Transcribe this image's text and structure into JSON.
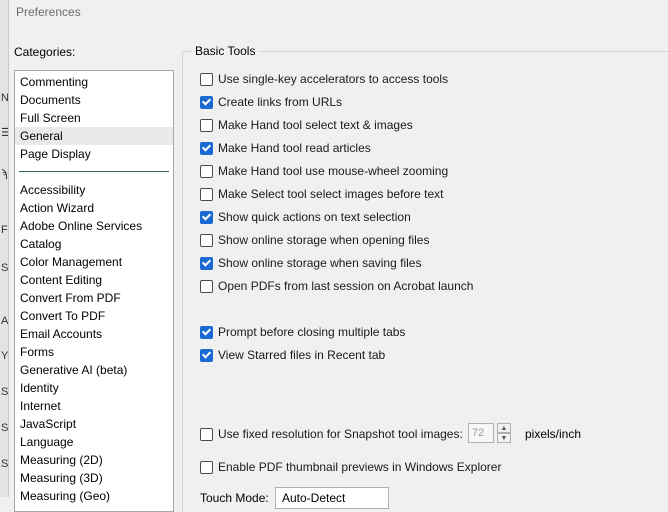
{
  "window": {
    "title": "Preferences"
  },
  "background_fragments": [
    "NI",
    "☰",
    "ϡ",
    "F",
    "S",
    "A",
    "Y",
    "S",
    "S",
    "S"
  ],
  "categories": {
    "label": "Categories:",
    "primary": [
      {
        "label": "Commenting"
      },
      {
        "label": "Documents"
      },
      {
        "label": "Full Screen"
      },
      {
        "label": "General",
        "selected": true
      },
      {
        "label": "Page Display"
      }
    ],
    "secondary": [
      {
        "label": "Accessibility"
      },
      {
        "label": "Action Wizard"
      },
      {
        "label": "Adobe Online Services"
      },
      {
        "label": "Catalog"
      },
      {
        "label": "Color Management"
      },
      {
        "label": "Content Editing"
      },
      {
        "label": "Convert From PDF"
      },
      {
        "label": "Convert To PDF"
      },
      {
        "label": "Email Accounts"
      },
      {
        "label": "Forms"
      },
      {
        "label": "Generative AI (beta)"
      },
      {
        "label": "Identity"
      },
      {
        "label": "Internet"
      },
      {
        "label": "JavaScript"
      },
      {
        "label": "Language"
      },
      {
        "label": "Measuring (2D)"
      },
      {
        "label": "Measuring (3D)"
      },
      {
        "label": "Measuring (Geo)"
      }
    ]
  },
  "basic_tools": {
    "legend": "Basic Tools",
    "options": [
      {
        "label": "Use single-key accelerators to access tools",
        "checked": false
      },
      {
        "label": "Create links from URLs",
        "checked": true
      },
      {
        "label": "Make Hand tool select text & images",
        "checked": false
      },
      {
        "label": "Make Hand tool read articles",
        "checked": true
      },
      {
        "label": "Make Hand tool use mouse-wheel zooming",
        "checked": false
      },
      {
        "label": "Make Select tool select images before text",
        "checked": false
      },
      {
        "label": "Show quick actions on text selection",
        "checked": true
      },
      {
        "label": "Show online storage when opening files",
        "checked": false
      },
      {
        "label": "Show online storage when saving files",
        "checked": true
      },
      {
        "label": "Open PDFs from last session on Acrobat launch",
        "checked": false
      },
      {
        "label": "Prompt before closing multiple tabs",
        "checked": true
      },
      {
        "label": "View Starred files in Recent tab",
        "checked": true
      },
      {
        "label": "Use fixed resolution for Snapshot tool images:",
        "checked": false
      },
      {
        "label": "Enable PDF thumbnail previews in Windows Explorer",
        "checked": false
      }
    ],
    "resolution": {
      "value": "72",
      "unit": "pixels/inch"
    },
    "touch_mode": {
      "label": "Touch Mode:",
      "value": "Auto-Detect"
    }
  }
}
